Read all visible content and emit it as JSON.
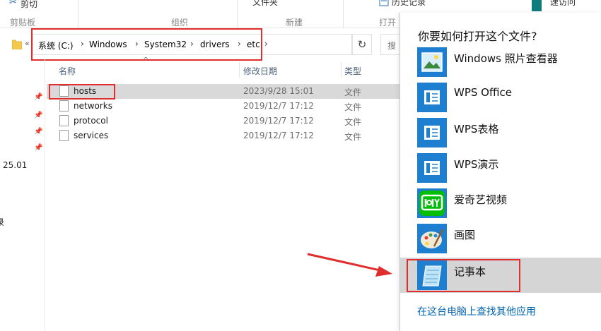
{
  "ribbon": {
    "cut_label": "剪切",
    "clipboard_label": "剪贴板",
    "organize_label": "组织",
    "folder_label": "文件夹",
    "new_label": "新建",
    "open_label": "打开",
    "history_label": "历史记录",
    "access_label": "速访问"
  },
  "address": {
    "back_glyph": "«",
    "segments": [
      "系统 (C:)",
      "Windows",
      "System32",
      "drivers",
      "etc"
    ],
    "search_placeholder": "搜"
  },
  "nav": {
    "partial_text_1": "25.01",
    "partial_text_2": "录"
  },
  "columns": {
    "name": "名称",
    "modified": "修改日期",
    "type": "类型"
  },
  "files": [
    {
      "name": "hosts",
      "modified": "2023/9/28 15:01",
      "type": "文件"
    },
    {
      "name": "networks",
      "modified": "2019/12/7 17:12",
      "type": "文件"
    },
    {
      "name": "protocol",
      "modified": "2019/12/7 17:12",
      "type": "文件"
    },
    {
      "name": "services",
      "modified": "2019/12/7 17:12",
      "type": "文件"
    }
  ],
  "open_with": {
    "title": "你要如何打开这个文件?",
    "apps": [
      {
        "label": "Windows 照片查看器",
        "icon": "photo-viewer-icon"
      },
      {
        "label": "WPS Office",
        "icon": "wps-icon"
      },
      {
        "label": "WPS表格",
        "icon": "wps-icon"
      },
      {
        "label": "WPS演示",
        "icon": "wps-icon"
      },
      {
        "label": "爱奇艺视频",
        "icon": "iqiyi-icon"
      },
      {
        "label": "画图",
        "icon": "paint-palette-icon"
      },
      {
        "label": "记事本",
        "icon": "notepad-icon"
      }
    ],
    "more_apps_link": "在这台电脑上查找其他应用"
  },
  "colors": {
    "annotation_red": "#e02e2e",
    "selection_gray": "#d9d9d9",
    "link_blue": "#0063b1",
    "app_tile_blue": "#1e7ed0"
  }
}
